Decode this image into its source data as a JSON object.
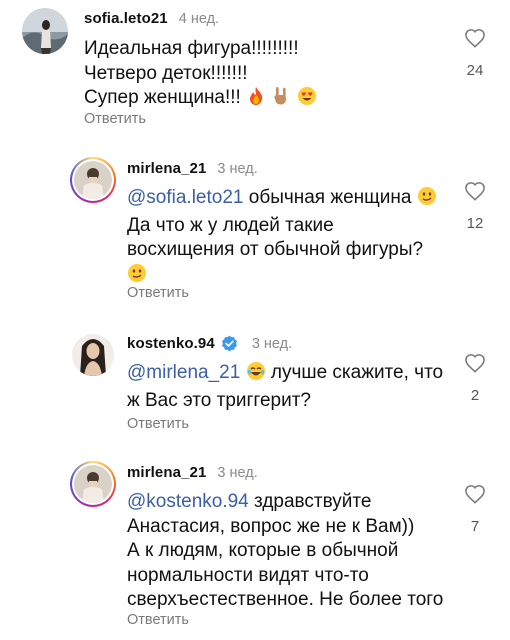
{
  "comments": [
    {
      "username": "sofia.leto21",
      "time": "4 нед.",
      "lines": [
        "Идеальная фигура!!!!!!!!!",
        "Четверо деток!!!!!!!",
        "Супер женщина!!!"
      ],
      "reply_label": "Ответить",
      "likes": "24"
    },
    {
      "username": "mirlena_21",
      "time": "3 нед.",
      "mention": "@sofia.leto21",
      "lines": [
        " обычная женщина",
        "Да что ж у людей такие",
        "восхищения от обычной фигуры?"
      ],
      "reply_label": "Ответить",
      "likes": "12"
    },
    {
      "username": "kostenko.94",
      "time": "3 нед.",
      "mention": "@mirlena_21",
      "lines": [
        " лучше скажите, что",
        "ж Вас это триггерит?"
      ],
      "reply_label": "Ответить",
      "likes": "2"
    },
    {
      "username": "mirlena_21",
      "time": "3 нед.",
      "mention": "@kostenko.94",
      "lines": [
        " здравствуйте",
        "Анастасия, вопрос же не к Вам))",
        "А к людям, которые в обычной",
        "нормальности видят что-то",
        "сверхъестественное. Не более того"
      ],
      "reply_label": "Ответить",
      "likes": "7"
    }
  ],
  "icons": {
    "like": "heart-outline-icon",
    "verified": "verified-badge-icon",
    "emoji_fire": "fire-emoji",
    "emoji_rock": "rock-hand-emoji",
    "emoji_heart_eyes": "heart-eyes-emoji",
    "emoji_smirk": "smirk-emoji",
    "emoji_laugh": "tears-of-joy-emoji"
  },
  "colors": {
    "mention": "#3a5fa8",
    "verified": "#3897f0",
    "muted": "#8a8a8a"
  }
}
